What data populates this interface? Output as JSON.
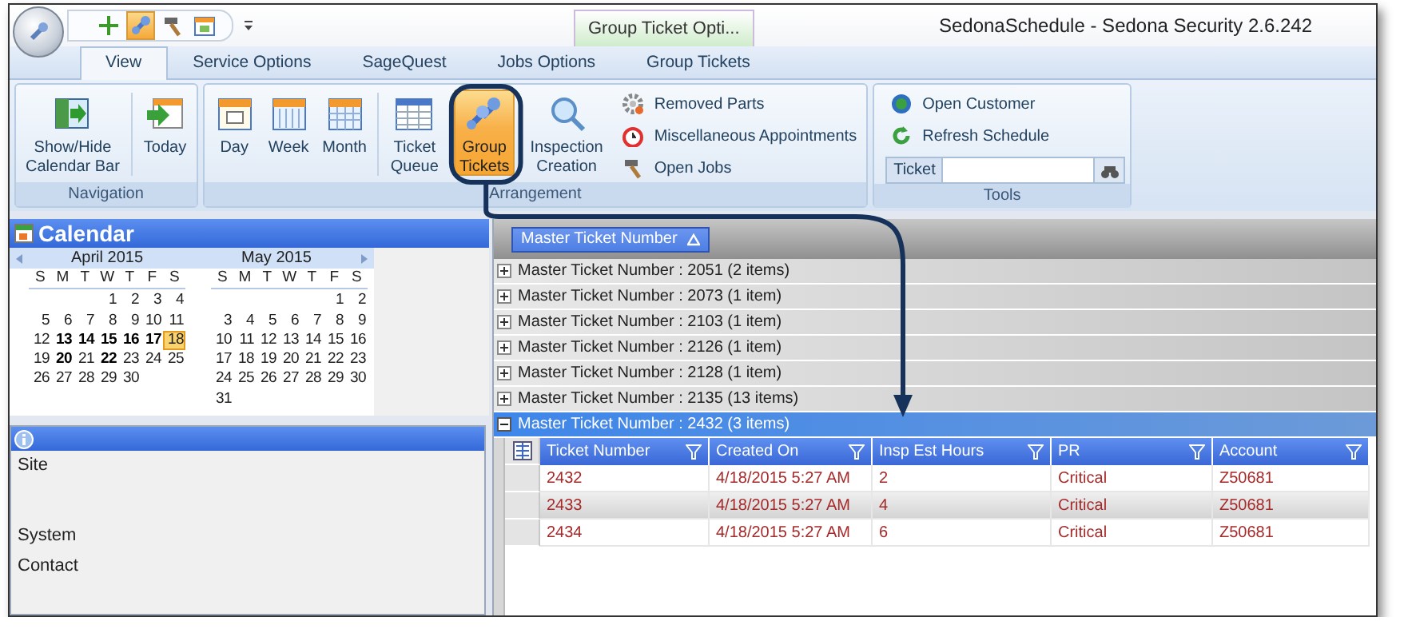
{
  "window": {
    "title": "SedonaSchedule - Sedona Security 2.6.242"
  },
  "quick_access": [
    {
      "kind": "add",
      "selected": false
    },
    {
      "kind": "tools",
      "selected": true
    },
    {
      "kind": "hammer",
      "selected": false
    },
    {
      "kind": "calendar",
      "selected": false
    }
  ],
  "context_tab": "Group Ticket Opti...",
  "tabs": [
    {
      "label": "View",
      "selected": true
    },
    {
      "label": "Service Options",
      "selected": false
    },
    {
      "label": "SageQuest",
      "selected": false
    },
    {
      "label": "Jobs Options",
      "selected": false
    },
    {
      "label": "Group Tickets",
      "selected": false
    }
  ],
  "ribbon": {
    "groups": [
      {
        "label": "Navigation",
        "items": [
          {
            "kind": "large",
            "label": "Show/Hide\nCalendar Bar",
            "selected": false
          },
          {
            "kind": "separator"
          },
          {
            "kind": "large",
            "label": "Today",
            "selected": false
          }
        ]
      },
      {
        "label": "Arrangement",
        "items": [
          {
            "kind": "large",
            "label": "Day",
            "selected": false
          },
          {
            "kind": "large",
            "label": "Week",
            "selected": false
          },
          {
            "kind": "large",
            "label": "Month",
            "selected": false
          },
          {
            "kind": "separator"
          },
          {
            "kind": "large",
            "label": "Ticket\nQueue",
            "selected": false
          },
          {
            "kind": "large",
            "label": "Group\nTickets",
            "selected": true
          },
          {
            "kind": "large",
            "label": "Inspection\nCreation",
            "selected": false
          },
          {
            "kind": "stack",
            "entries": [
              "Removed Parts",
              "Miscellaneous Appointments",
              "Open Jobs"
            ]
          }
        ]
      },
      {
        "label": "Tools",
        "items": [
          {
            "kind": "stack",
            "entries": [
              "Open Customer",
              "Refresh Schedule"
            ]
          },
          {
            "kind": "field",
            "label": "Ticket"
          }
        ]
      }
    ]
  },
  "calendar": {
    "title": "Calendar",
    "months": [
      {
        "title": "April 2015",
        "weekdays": [
          "S",
          "M",
          "T",
          "W",
          "T",
          "F",
          "S"
        ],
        "weeks": [
          [
            {
              "day": "1",
              "bold": false,
              "selected": false
            },
            {
              "day": "2",
              "bold": false,
              "selected": false
            },
            {
              "day": "3",
              "bold": false,
              "selected": false
            },
            {
              "day": "4",
              "bold": false,
              "selected": false
            }
          ],
          [
            {
              "day": "5",
              "bold": false,
              "selected": false
            },
            {
              "day": "6",
              "bold": false,
              "selected": false
            },
            {
              "day": "7",
              "bold": false,
              "selected": false
            },
            {
              "day": "8",
              "bold": false,
              "selected": false
            },
            {
              "day": "9",
              "bold": false,
              "selected": false
            },
            {
              "day": "10",
              "bold": false,
              "selected": false
            },
            {
              "day": "11",
              "bold": false,
              "selected": false
            }
          ],
          [
            {
              "day": "12",
              "bold": false,
              "selected": false
            },
            {
              "day": "13",
              "bold": true,
              "selected": false
            },
            {
              "day": "14",
              "bold": true,
              "selected": false
            },
            {
              "day": "15",
              "bold": true,
              "selected": false
            },
            {
              "day": "16",
              "bold": true,
              "selected": false
            },
            {
              "day": "17",
              "bold": true,
              "selected": false
            },
            {
              "day": "18",
              "bold": false,
              "selected": true
            }
          ],
          [
            {
              "day": "19",
              "bold": false,
              "selected": false
            },
            {
              "day": "20",
              "bold": true,
              "selected": false
            },
            {
              "day": "21",
              "bold": false,
              "selected": false
            },
            {
              "day": "22",
              "bold": true,
              "selected": false
            },
            {
              "day": "23",
              "bold": false,
              "selected": false
            },
            {
              "day": "24",
              "bold": false,
              "selected": false
            },
            {
              "day": "25",
              "bold": false,
              "selected": false
            }
          ],
          [
            {
              "day": "26",
              "bold": false,
              "selected": false
            },
            {
              "day": "27",
              "bold": false,
              "selected": false
            },
            {
              "day": "28",
              "bold": false,
              "selected": false
            },
            {
              "day": "29",
              "bold": false,
              "selected": false
            },
            {
              "day": "30",
              "bold": false,
              "selected": false
            }
          ]
        ]
      },
      {
        "title": "May 2015",
        "weekdays": [
          "S",
          "M",
          "T",
          "W",
          "T",
          "F",
          "S"
        ],
        "weeks": [
          [
            {
              "day": "1",
              "bold": false,
              "selected": false
            },
            {
              "day": "2",
              "bold": false,
              "selected": false
            }
          ],
          [
            {
              "day": "3",
              "bold": false,
              "selected": false
            },
            {
              "day": "4",
              "bold": false,
              "selected": false
            },
            {
              "day": "5",
              "bold": false,
              "selected": false
            },
            {
              "day": "6",
              "bold": false,
              "selected": false
            },
            {
              "day": "7",
              "bold": false,
              "selected": false
            },
            {
              "day": "8",
              "bold": false,
              "selected": false
            },
            {
              "day": "9",
              "bold": false,
              "selected": false
            }
          ],
          [
            {
              "day": "10",
              "bold": false,
              "selected": false
            },
            {
              "day": "11",
              "bold": false,
              "selected": false
            },
            {
              "day": "12",
              "bold": false,
              "selected": false
            },
            {
              "day": "13",
              "bold": false,
              "selected": false
            },
            {
              "day": "14",
              "bold": false,
              "selected": false
            },
            {
              "day": "15",
              "bold": false,
              "selected": false
            },
            {
              "day": "16",
              "bold": false,
              "selected": false
            }
          ],
          [
            {
              "day": "17",
              "bold": false,
              "selected": false
            },
            {
              "day": "18",
              "bold": false,
              "selected": false
            },
            {
              "day": "19",
              "bold": false,
              "selected": false
            },
            {
              "day": "20",
              "bold": false,
              "selected": false
            },
            {
              "day": "21",
              "bold": false,
              "selected": false
            },
            {
              "day": "22",
              "bold": false,
              "selected": false
            },
            {
              "day": "23",
              "bold": false,
              "selected": false
            }
          ],
          [
            {
              "day": "24",
              "bold": false,
              "selected": false
            },
            {
              "day": "25",
              "bold": false,
              "selected": false
            },
            {
              "day": "26",
              "bold": false,
              "selected": false
            },
            {
              "day": "27",
              "bold": false,
              "selected": false
            },
            {
              "day": "28",
              "bold": false,
              "selected": false
            },
            {
              "day": "29",
              "bold": false,
              "selected": false
            },
            {
              "day": "30",
              "bold": false,
              "selected": false
            }
          ],
          [
            {
              "day": "31",
              "bold": false,
              "selected": false
            }
          ]
        ]
      }
    ]
  },
  "info_panel": {
    "fields": [
      "Site",
      "System",
      "Contact"
    ]
  },
  "grid": {
    "group_by": "Master Ticket Number",
    "groups": [
      {
        "label": "Master Ticket Number : 2051 (2 items)",
        "expanded": false
      },
      {
        "label": "Master Ticket Number : 2073 (1 item)",
        "expanded": false
      },
      {
        "label": "Master Ticket Number : 2103 (1 item)",
        "expanded": false
      },
      {
        "label": "Master Ticket Number : 2126 (1 item)",
        "expanded": false
      },
      {
        "label": "Master Ticket Number : 2128 (1 item)",
        "expanded": false
      },
      {
        "label": "Master Ticket Number : 2135 (13 items)",
        "expanded": false
      },
      {
        "label": "Master Ticket Number : 2432 (3 items)",
        "expanded": true,
        "columns": [
          "Ticket Number",
          "Created On",
          "Insp Est Hours",
          "PR",
          "Account"
        ],
        "rows": [
          {
            "cells": [
              "2432",
              "4/18/2015 5:27 AM",
              "2",
              "Critical",
              "Z50681"
            ],
            "selected": false
          },
          {
            "cells": [
              "2433",
              "4/18/2015 5:27 AM",
              "4",
              "Critical",
              "Z50681"
            ],
            "selected": true
          },
          {
            "cells": [
              "2434",
              "4/18/2015 5:27 AM",
              "6",
              "Critical",
              "Z50681"
            ],
            "selected": false
          }
        ]
      }
    ]
  }
}
